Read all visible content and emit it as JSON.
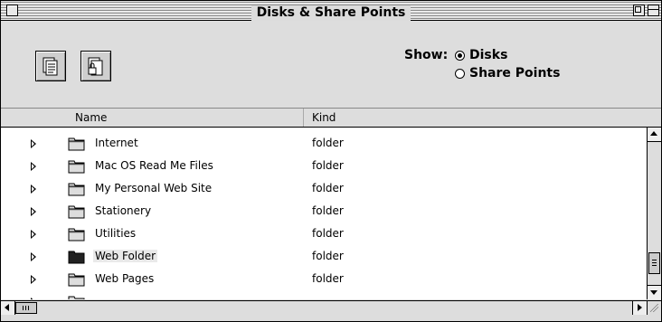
{
  "window": {
    "title": "Disks & Share Points"
  },
  "toolbar": {
    "show_label": "Show:",
    "options": [
      {
        "label": "Disks",
        "selected": true
      },
      {
        "label": "Share Points",
        "selected": false
      }
    ]
  },
  "columns": {
    "name": "Name",
    "kind": "Kind"
  },
  "rows": [
    {
      "name": "Internet",
      "kind": "folder",
      "icon": "folder-icon"
    },
    {
      "name": "Mac OS Read Me Files",
      "kind": "folder",
      "icon": "folder-icon"
    },
    {
      "name": "My Personal Web Site",
      "kind": "folder",
      "icon": "folder-icon"
    },
    {
      "name": "Stationery",
      "kind": "folder",
      "icon": "folder-icon"
    },
    {
      "name": "Utilities",
      "kind": "folder",
      "icon": "folder-icon"
    },
    {
      "name": "Web Folder",
      "kind": "folder",
      "icon": "folder-selected-icon",
      "selected": true
    },
    {
      "name": "Web Pages",
      "kind": "folder",
      "icon": "folder-icon"
    }
  ]
}
